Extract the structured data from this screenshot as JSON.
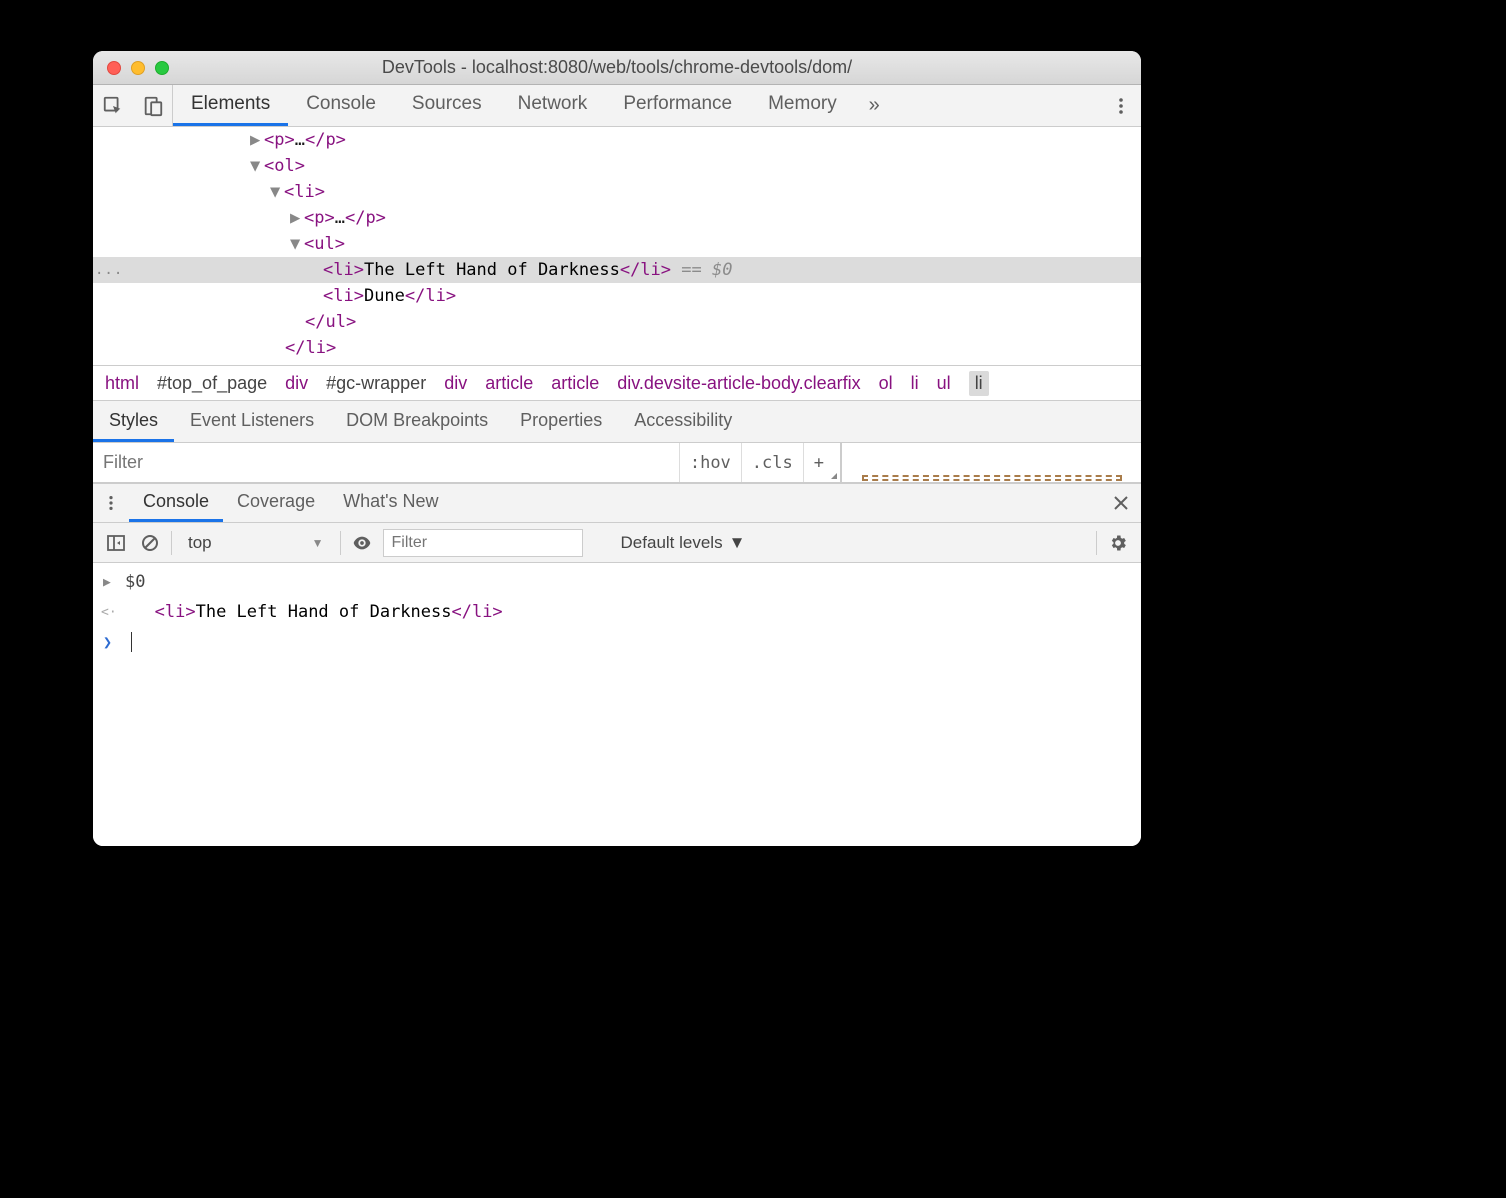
{
  "title": "DevTools - localhost:8080/web/tools/chrome-devtools/dom/",
  "main_tabs": [
    "Elements",
    "Console",
    "Sources",
    "Network",
    "Performance",
    "Memory"
  ],
  "main_tabs_active": 0,
  "dom_tree": {
    "lines": [
      {
        "indent": 157,
        "tri": "▶",
        "open": "<p>",
        "text": "…",
        "close": "</p>"
      },
      {
        "indent": 157,
        "tri": "▼",
        "open": "<ol>",
        "text": "",
        "close": ""
      },
      {
        "indent": 177,
        "tri": "▼",
        "open": "<li>",
        "text": "",
        "close": ""
      },
      {
        "indent": 197,
        "tri": "▶",
        "open": "<p>",
        "text": "…",
        "close": "</p>"
      },
      {
        "indent": 197,
        "tri": "▼",
        "open": "<ul>",
        "text": "",
        "close": ""
      },
      {
        "indent": 230,
        "tri": "",
        "open": "<li>",
        "text": "The Left Hand of Darkness",
        "close": "</li>",
        "selected": true,
        "suffix": " == $0"
      },
      {
        "indent": 230,
        "tri": "",
        "open": "<li>",
        "text": "Dune",
        "close": "</li>"
      },
      {
        "indent": 212,
        "tri": "",
        "open": "</ul>",
        "text": "",
        "close": ""
      },
      {
        "indent": 192,
        "tri": "",
        "open": "</li>",
        "text": "",
        "close": ""
      }
    ]
  },
  "breadcrumbs": [
    {
      "label": "html",
      "cls": ""
    },
    {
      "label": "#top_of_page",
      "cls": "id"
    },
    {
      "label": "div",
      "cls": ""
    },
    {
      "label": "#gc-wrapper",
      "cls": "id"
    },
    {
      "label": "div",
      "cls": ""
    },
    {
      "label": "article",
      "cls": ""
    },
    {
      "label": "article",
      "cls": ""
    },
    {
      "label": "div.devsite-article-body.clearfix",
      "cls": ""
    },
    {
      "label": "ol",
      "cls": ""
    },
    {
      "label": "li",
      "cls": ""
    },
    {
      "label": "ul",
      "cls": ""
    },
    {
      "label": "li",
      "cls": "selected"
    }
  ],
  "styles_tabs": [
    "Styles",
    "Event Listeners",
    "DOM Breakpoints",
    "Properties",
    "Accessibility"
  ],
  "styles_tabs_active": 0,
  "styles_filter_placeholder": "Filter",
  "hov_label": ":hov",
  "cls_label": ".cls",
  "drawer_tabs": [
    "Console",
    "Coverage",
    "What's New"
  ],
  "drawer_tabs_active": 0,
  "console": {
    "context": "top",
    "filter_placeholder": "Filter",
    "levels": "Default levels",
    "lines": [
      {
        "prompt": "expand",
        "text": "$0"
      },
      {
        "prompt": "output",
        "html_open": "<li>",
        "html_text": "The Left Hand of Darkness",
        "html_close": "</li>"
      },
      {
        "prompt": "input",
        "text": ""
      }
    ]
  }
}
